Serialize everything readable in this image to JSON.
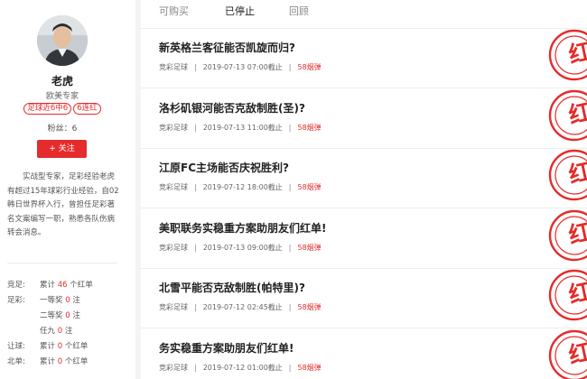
{
  "profile": {
    "name": "老虎",
    "title": "欧美专家",
    "badges": [
      "足球近6中6",
      "6连红"
    ],
    "fans_label": "粉丝：",
    "fans_count": "6",
    "follow_label": "+ 关注",
    "bio": "实战型专家，足彩经验老虎有超过15年球彩行业经验，自02韩日世界杯入行，曾担任足彩著名文案编写一职，熟悉各队伤病转会消息。"
  },
  "stats": [
    {
      "label": "竞足:",
      "prefix": "累计",
      "num": "46",
      "suffix": "个红单"
    },
    {
      "label": "足彩:",
      "prefix": "一等奖",
      "num": "0",
      "suffix": "注"
    },
    {
      "label": "",
      "prefix": "二等奖",
      "num": "0",
      "suffix": "注"
    },
    {
      "label": "",
      "prefix": "任九",
      "num": "0",
      "suffix": "注"
    },
    {
      "label": "让球:",
      "prefix": "累计",
      "num": "0",
      "suffix": "个红单"
    },
    {
      "label": "北单:",
      "prefix": "累计",
      "num": "0",
      "suffix": "个红单"
    }
  ],
  "tabs": [
    "可购买",
    "已停止",
    "回顾"
  ],
  "active_tab": "已停止",
  "items": [
    {
      "title": "新英格兰客征能否凯旋而归?",
      "category": "竞彩足球",
      "time": "2019-07-13 07:00截止",
      "price": "58烟弹"
    },
    {
      "title": "洛杉矶银河能否克敌制胜(圣)?",
      "category": "竞彩足球",
      "time": "2019-07-13 11:00截止",
      "price": "58烟弹"
    },
    {
      "title": "江原FC主场能否庆祝胜利?",
      "category": "竞彩足球",
      "time": "2019-07-12 18:00截止",
      "price": "58烟弹"
    },
    {
      "title": "美职联务实稳重方案助朋友们红单!",
      "category": "竞彩足球",
      "time": "2019-07-13 09:00截止",
      "price": "58烟弹"
    },
    {
      "title": "北雪平能否克敌制胜(帕特里)?",
      "category": "竞彩足球",
      "time": "2019-07-12 02:45截止",
      "price": "58烟弹"
    },
    {
      "title": "务实稳重方案助朋友们红单!",
      "category": "竞彩足球",
      "time": "2019-07-12 01:00截止",
      "price": "58烟弹"
    }
  ],
  "stamp_text": "红",
  "colors": {
    "accent": "#e52b2b",
    "text": "#222222",
    "muted": "#666666"
  }
}
